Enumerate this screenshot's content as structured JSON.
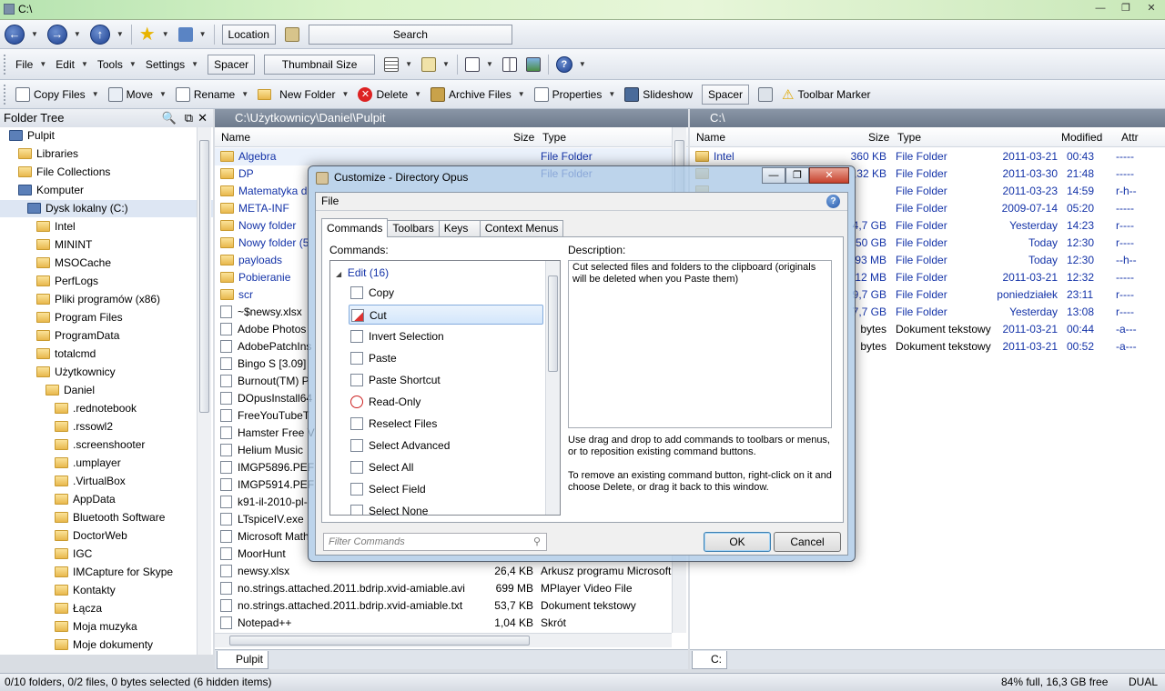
{
  "window": {
    "title": "C:\\"
  },
  "toolbar1": {
    "location_label": "Location",
    "search_label": "Search"
  },
  "toolbar2": {
    "menus": [
      "File",
      "Edit",
      "Tools",
      "Settings"
    ],
    "spacer": "Spacer",
    "thumbnail": "Thumbnail Size"
  },
  "toolbar3": {
    "copy": "Copy Files",
    "move": "Move",
    "rename": "Rename",
    "newfolder": "New Folder",
    "delete": "Delete",
    "archive": "Archive Files",
    "properties": "Properties",
    "slideshow": "Slideshow",
    "spacer": "Spacer",
    "marker": "Toolbar Marker"
  },
  "tree": {
    "title": "Folder Tree",
    "items": [
      "Pulpit",
      "Libraries",
      "File Collections",
      "Komputer",
      "Dysk lokalny (C:)",
      "Intel",
      "MININT",
      "MSOCache",
      "PerfLogs",
      "Pliki programów (x86)",
      "Program Files",
      "ProgramData",
      "totalcmd",
      "Użytkownicy",
      "Daniel",
      ".rednotebook",
      ".rssowl2",
      ".screenshooter",
      ".umplayer",
      ".VirtualBox",
      "AppData",
      "Bluetooth Software",
      "DoctorWeb",
      "IGC",
      "IMCapture for Skype",
      "Kontakty",
      "Łącza",
      "Moja muzyka",
      "Moje dokumenty"
    ]
  },
  "left": {
    "path": "C:\\Użytkownicy\\Daniel\\Pulpit",
    "col_name": "Name",
    "col_size": "Size",
    "col_type": "Type",
    "tab": "Pulpit",
    "rows": [
      {
        "name": "Algebra",
        "size": "",
        "type": "File Folder",
        "folder": true
      },
      {
        "name": "DP",
        "size": "",
        "type": "File Folder",
        "folder": true
      },
      {
        "name": "Matematyka d",
        "size": "",
        "type": "",
        "folder": true
      },
      {
        "name": "META-INF",
        "size": "",
        "type": "",
        "folder": true
      },
      {
        "name": "Nowy folder",
        "size": "",
        "type": "",
        "folder": true
      },
      {
        "name": "Nowy folder (5",
        "size": "",
        "type": "",
        "folder": true
      },
      {
        "name": "payloads",
        "size": "",
        "type": "",
        "folder": true
      },
      {
        "name": "Pobieranie",
        "size": "",
        "type": "",
        "folder": true
      },
      {
        "name": "scr",
        "size": "",
        "type": "",
        "folder": true
      },
      {
        "name": "~$newsy.xlsx",
        "size": "",
        "type": "",
        "folder": false
      },
      {
        "name": "Adobe Photos",
        "size": "",
        "type": "",
        "folder": false
      },
      {
        "name": "AdobePatchIns",
        "size": "",
        "type": "",
        "folder": false
      },
      {
        "name": "Bingo S [3.09]",
        "size": "",
        "type": "",
        "folder": false
      },
      {
        "name": "Burnout(TM) P",
        "size": "",
        "type": "",
        "folder": false
      },
      {
        "name": "DOpusInstall64",
        "size": "",
        "type": "",
        "folder": false
      },
      {
        "name": "FreeYouTubeT",
        "size": "",
        "type": "",
        "folder": false
      },
      {
        "name": "Hamster Free V",
        "size": "",
        "type": "",
        "folder": false
      },
      {
        "name": "Helium Music",
        "size": "",
        "type": "",
        "folder": false
      },
      {
        "name": "IMGP5896.PEF",
        "size": "",
        "type": "",
        "folder": false
      },
      {
        "name": "IMGP5914.PEF",
        "size": "",
        "type": "",
        "folder": false
      },
      {
        "name": "k91-il-2010-pl-",
        "size": "",
        "type": "",
        "folder": false
      },
      {
        "name": "LTspiceIV.exe",
        "size": "",
        "type": "",
        "folder": false
      },
      {
        "name": "Microsoft Math",
        "size": "",
        "type": "",
        "folder": false
      },
      {
        "name": "MoorHunt",
        "size": "",
        "type": "",
        "folder": false
      },
      {
        "name": "newsy.xlsx",
        "size": "26,4 KB",
        "type": "Arkusz programu Microsoft",
        "folder": false
      },
      {
        "name": "no.strings.attached.2011.bdrip.xvid-amiable.avi",
        "size": "699 MB",
        "type": "MPlayer Video File",
        "folder": false
      },
      {
        "name": "no.strings.attached.2011.bdrip.xvid-amiable.txt",
        "size": "53,7 KB",
        "type": "Dokument tekstowy",
        "folder": false
      },
      {
        "name": "Notepad++",
        "size": "1,04 KB",
        "type": "Skrót",
        "folder": false
      }
    ]
  },
  "right": {
    "path": "C:\\",
    "col_name": "Name",
    "col_size": "Size",
    "col_type": "Type",
    "col_modified": "Modified",
    "col_attr": "Attr",
    "tab": "C:",
    "rows": [
      {
        "name": "Intel",
        "size": "360 KB",
        "type": "File Folder",
        "date": "2011-03-21",
        "time": "00:43",
        "attr": "-----"
      },
      {
        "name": "",
        "size": ",32 KB",
        "type": "File Folder",
        "date": "2011-03-30",
        "time": "21:48",
        "attr": "-----"
      },
      {
        "name": "",
        "size": "",
        "type": "File Folder",
        "date": "2011-03-23",
        "time": "14:59",
        "attr": "r-h--"
      },
      {
        "name": "",
        "size": "",
        "type": "File Folder",
        "date": "2009-07-14",
        "time": "05:20",
        "attr": "-----"
      },
      {
        "name": "",
        "size": "4,7 GB",
        "type": "File Folder",
        "date": "Yesterday",
        "time": "14:23",
        "attr": "r----"
      },
      {
        "name": "",
        "size": "50 GB",
        "type": "File Folder",
        "date": "Today",
        "time": "12:30",
        "attr": "r----"
      },
      {
        "name": "",
        "size": "93 MB",
        "type": "File Folder",
        "date": "Today",
        "time": "12:30",
        "attr": "--h--"
      },
      {
        "name": "",
        "size": "12 MB",
        "type": "File Folder",
        "date": "2011-03-21",
        "time": "12:32",
        "attr": "-----"
      },
      {
        "name": "",
        "size": "9,7 GB",
        "type": "File Folder",
        "date": "poniedziałek",
        "time": "23:11",
        "attr": "r----"
      },
      {
        "name": "",
        "size": "7,7 GB",
        "type": "File Folder",
        "date": "Yesterday",
        "time": "13:08",
        "attr": "r----"
      },
      {
        "name": "",
        "size": "bytes",
        "type": "Dokument tekstowy",
        "date": "2011-03-21",
        "time": "00:44",
        "attr": "-a---"
      },
      {
        "name": "",
        "size": "bytes",
        "type": "Dokument tekstowy",
        "date": "2011-03-21",
        "time": "00:52",
        "attr": "-a---"
      }
    ]
  },
  "status": {
    "left": "0/10 folders, 0/2 files, 0 bytes selected (6 hidden items)",
    "right": "84% full, 16,3 GB free",
    "mode": "DUAL"
  },
  "dialog": {
    "title": "Customize - Directory Opus",
    "subtitle": "File",
    "tabs": [
      "Commands",
      "Toolbars",
      "Keys",
      "Context Menus"
    ],
    "commands_label": "Commands:",
    "group": "Edit (16)",
    "commands": [
      "Copy",
      "Cut",
      "Invert Selection",
      "Paste",
      "Paste Shortcut",
      "Read-Only",
      "Reselect Files",
      "Select Advanced",
      "Select All",
      "Select Field",
      "Select None"
    ],
    "desc_label": "Description:",
    "desc_text": "Cut selected files and folders to the clipboard (originals will be deleted when you Paste them)",
    "hint1": "Use drag and drop to add commands to toolbars or menus, or to reposition existing command buttons.",
    "hint2": "To remove an existing command button, right-click on it and choose Delete, or drag it back to this window.",
    "filter_placeholder": "Filter Commands",
    "ok": "OK",
    "cancel": "Cancel"
  }
}
